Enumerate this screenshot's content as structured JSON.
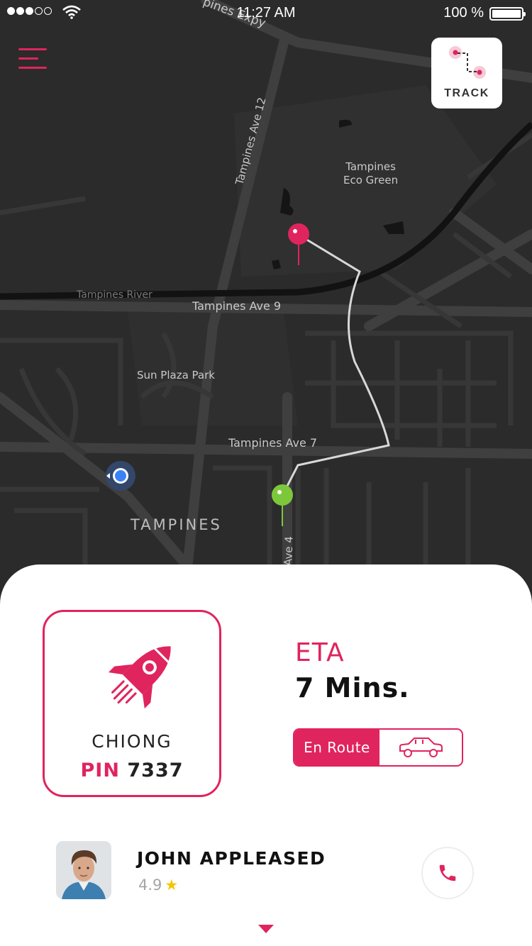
{
  "status_bar": {
    "time": "11:27 AM",
    "battery": "100 %",
    "signal_dots": 5,
    "signal_strength": 3
  },
  "header": {
    "menu_icon": "hamburger-menu-icon",
    "track_label": "TRACK",
    "track_icon": "route-icon"
  },
  "map": {
    "labels": {
      "expy": "pines Expy",
      "ave12": "Tampines Ave 12",
      "eco_green": "Tampines\nEco Green",
      "river": "Tampines River",
      "ave9": "Tampines Ave 9",
      "sun_plaza": "Sun Plaza Park",
      "ave7": "Tampines Ave 7",
      "area": "TAMPINES",
      "ave4": "Ave 4"
    },
    "destination_pin_color": "#e0245e",
    "origin_pin_color": "#7cc83a",
    "user_location_color": "#3b82f6"
  },
  "vehicle": {
    "icon": "rocket-icon",
    "driver_tag": "CHIONG",
    "pin_label": "PIN",
    "pin_value": "7337"
  },
  "eta": {
    "label": "ETA",
    "value": "7 Mins."
  },
  "status": {
    "label": "En Route",
    "icon": "car-icon"
  },
  "driver": {
    "name": "JOHN APPLEASED",
    "rating": "4.9",
    "star": "★",
    "call_icon": "phone-icon"
  },
  "colors": {
    "accent": "#e0245e",
    "map_bg": "#2b2b2b",
    "road": "#3e3e3e"
  }
}
